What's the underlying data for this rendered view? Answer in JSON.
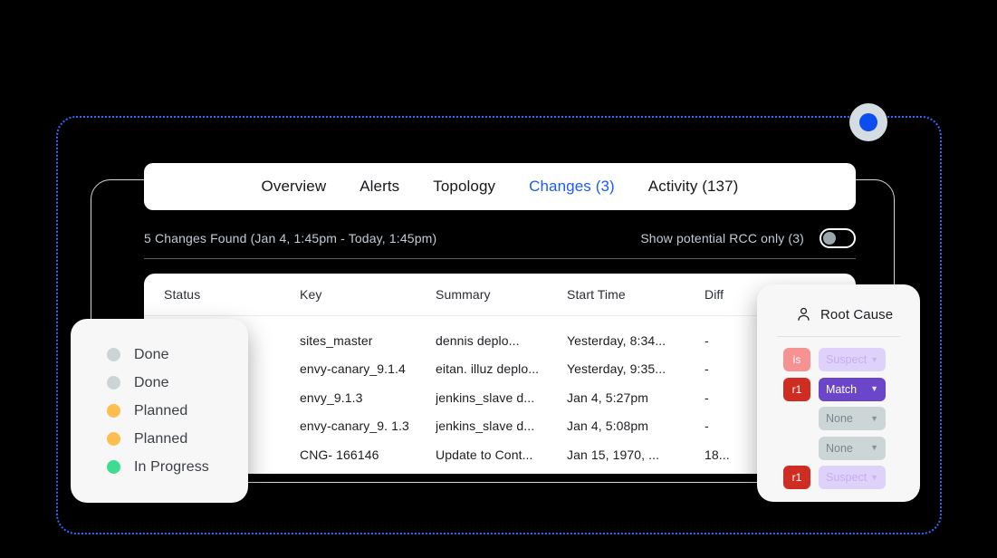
{
  "frame": {
    "accent_blue": "#2f6bff",
    "handle_dot_color": "#0b4df0"
  },
  "tabs": [
    {
      "label": "Overview",
      "active": false
    },
    {
      "label": "Alerts",
      "active": false
    },
    {
      "label": "Topology",
      "active": false
    },
    {
      "label": "Changes (3)",
      "active": true
    },
    {
      "label": "Activity (137)",
      "active": false
    }
  ],
  "toolbar": {
    "changes_found": "5 Changes Found (Jan 4, 1:45pm - Today, 1:45pm)",
    "rcc_toggle_label": "Show potential RCC only (3)",
    "rcc_toggle_state": "off"
  },
  "table": {
    "columns": [
      "Status",
      "Key",
      "Summary",
      "Start Time",
      "Diff"
    ],
    "rows": [
      {
        "status": "",
        "key": "sites_master",
        "summary": "dennis deplo...",
        "start_time": "Yesterday, 8:34...",
        "diff": "-"
      },
      {
        "status": "",
        "key": "envy-canary_9.1.4",
        "summary": "eitan. illuz deplo...",
        "start_time": "Yesterday, 9:35...",
        "diff": "-"
      },
      {
        "status": "",
        "key": "envy_9.1.3",
        "summary": "jenkins_slave d...",
        "start_time": "Jan 4, 5:27pm",
        "diff": "-"
      },
      {
        "status": "",
        "key": "envy-canary_9. 1.3",
        "summary": "jenkins_slave d...",
        "start_time": "Jan 4, 5:08pm",
        "diff": "-"
      },
      {
        "status": "",
        "key": "CNG- 166146",
        "summary": "Update to Cont...",
        "start_time": "Jan 15, 1970, ...",
        "diff": "18..."
      }
    ]
  },
  "status_panel": {
    "items": [
      {
        "label": "Done",
        "color": "#ccd4d6"
      },
      {
        "label": "Done",
        "color": "#ccd4d6"
      },
      {
        "label": "Planned",
        "color": "#fbbe4f"
      },
      {
        "label": "Planned",
        "color": "#fbbe4f"
      },
      {
        "label": "In Progress",
        "color": "#3ddc91"
      }
    ]
  },
  "root_cause_panel": {
    "icon": "person-icon",
    "title": "Root Cause",
    "rows": [
      {
        "badge": "is",
        "badge_color": "#f59392",
        "badge_text_color": "#ffffff",
        "value": "Suspect",
        "value_bg": "#ded2fb",
        "value_color": "#c3aef6"
      },
      {
        "badge": "r1",
        "badge_color": "#cf2d22",
        "badge_text_color": "#ffffff",
        "value": "Match",
        "value_bg": "#6b46c9",
        "value_color": "#ffffff"
      },
      {
        "badge": "",
        "badge_color": "transparent",
        "badge_text_color": "#ffffff",
        "value": "None",
        "value_bg": "#ccd6d6",
        "value_color": "#78868c"
      },
      {
        "badge": "",
        "badge_color": "transparent",
        "badge_text_color": "#ffffff",
        "value": "None",
        "value_bg": "#ccd6d6",
        "value_color": "#78868c"
      },
      {
        "badge": "r1",
        "badge_color": "#cf2d22",
        "badge_text_color": "#ffffff",
        "value": "Suspect",
        "value_bg": "#ded2fb",
        "value_color": "#c3aef6"
      }
    ]
  }
}
